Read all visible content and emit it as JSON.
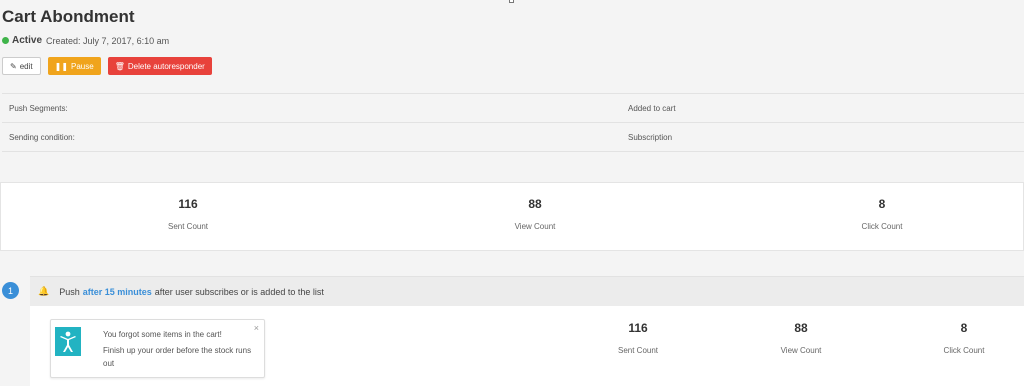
{
  "page": {
    "title": "Cart Abondment",
    "status": "Active",
    "created": "Created: July 7, 2017, 6:10 am"
  },
  "actions": {
    "edit": "edit",
    "pause": "Pause",
    "delete": "Delete autoresponder"
  },
  "info": {
    "push_segments_label": "Push Segments:",
    "push_segments_value": "Added to cart",
    "sending_condition_label": "Sending condition:",
    "sending_condition_value": "Subscription"
  },
  "stats": [
    {
      "value": "116",
      "label": "Sent Count"
    },
    {
      "value": "88",
      "label": "View Count"
    },
    {
      "value": "8",
      "label": "Click Count"
    }
  ],
  "step": {
    "number": "1",
    "prefix": "Push",
    "delay": "after 15 minutes",
    "suffix": "after user subscribes or is added to the list",
    "notification": {
      "line1": "You forgot some items in the cart!",
      "line2": "Finish up your order before the stock runs out",
      "close": "×"
    },
    "stats": [
      {
        "value": "116",
        "label": "Sent Count"
      },
      {
        "value": "88",
        "label": "View Count"
      },
      {
        "value": "8",
        "label": "Click Count"
      }
    ]
  },
  "icons": {
    "edit": "edit-icon",
    "pause": "pause-icon",
    "delete": "trash-icon",
    "bell": "bell-icon",
    "notification": "person-icon"
  },
  "colors": {
    "active": "#3fb44a",
    "pause": "#f0a41c",
    "delete": "#e8423b",
    "accent": "#3a8fd8",
    "notification_icon": "#22b3c2"
  }
}
